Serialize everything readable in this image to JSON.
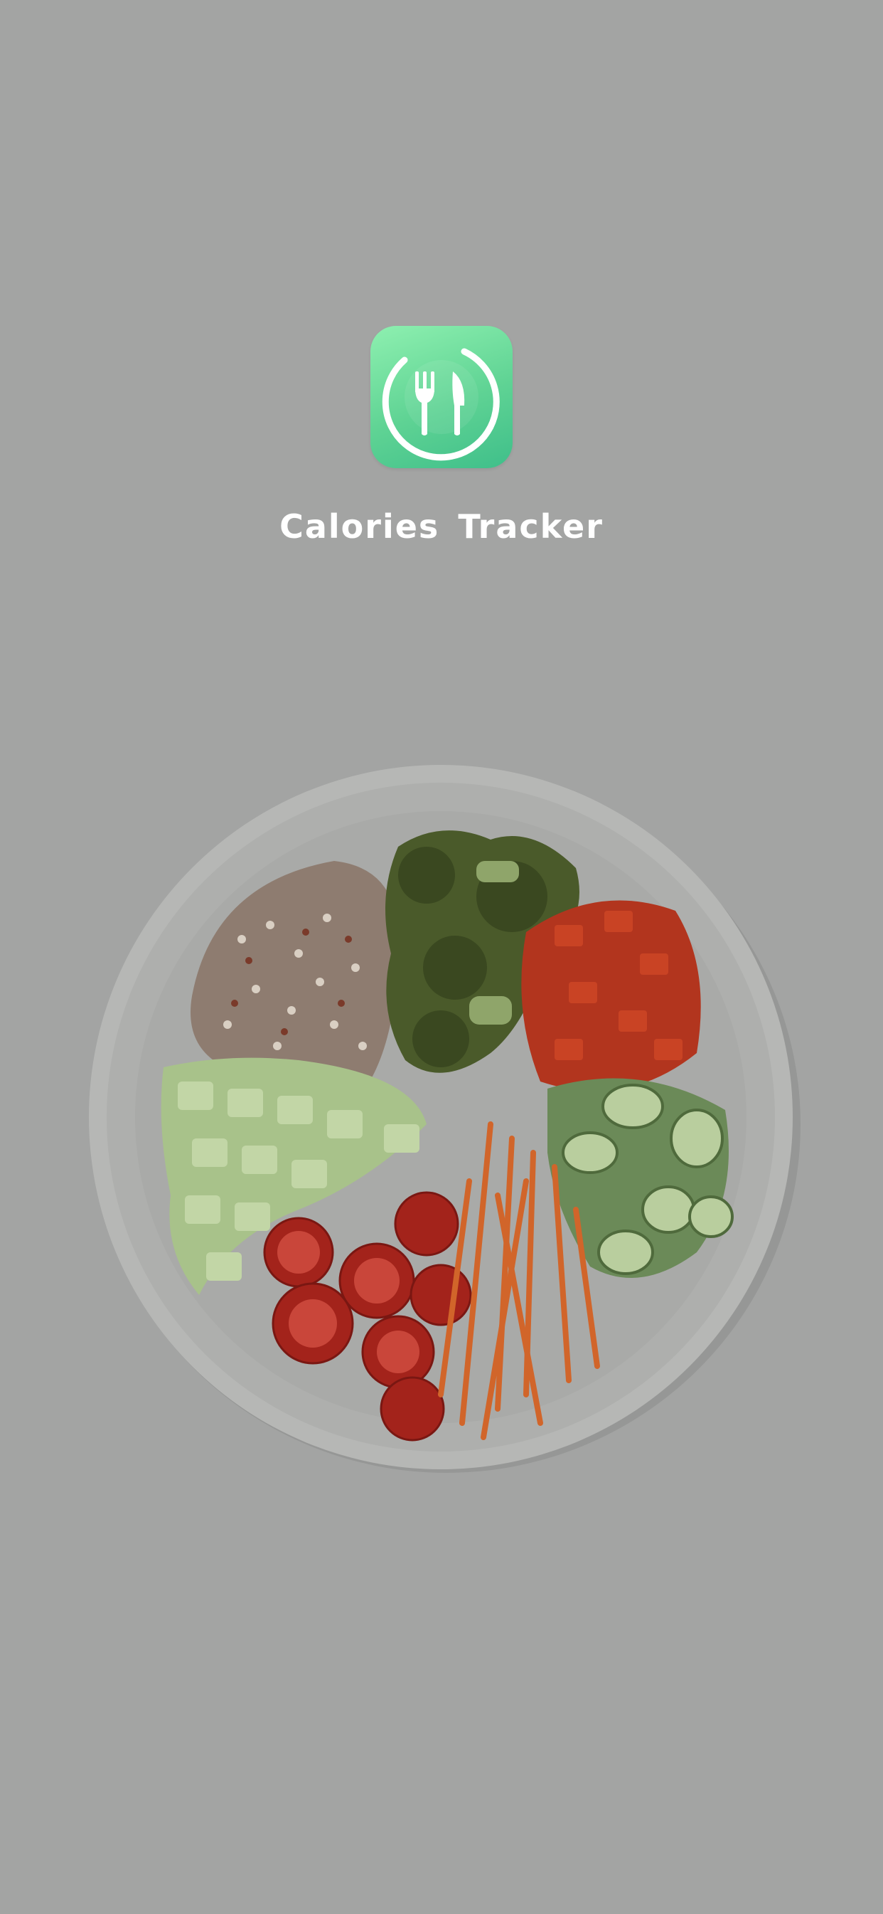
{
  "splash": {
    "app_name": "Calories Tracker",
    "app_icon": "fork-knife-ring-icon",
    "hero_image": "salad-bowl-illustration"
  },
  "colors": {
    "background": "#a3a4a3",
    "icon_gradient_start": "#8ef0b0",
    "icon_gradient_end": "#3fbf8a",
    "title_text": "#ffffff"
  }
}
